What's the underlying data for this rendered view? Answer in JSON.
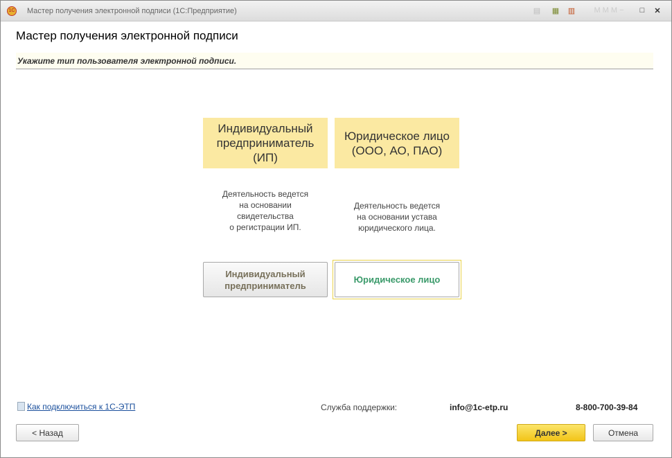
{
  "window": {
    "title": "Мастер получения электронной подписи  (1С:Предприятие)",
    "logo": "1С"
  },
  "header": {
    "title": "Мастер получения электронной подписи",
    "hint": "Укажите тип пользователя электронной подписи."
  },
  "options": [
    {
      "card": "Индивидуальный\nпредприниматель\n(ИП)",
      "description": "Деятельность ведется\nна основании\nсвидетельства\nо регистрации ИП.",
      "button": "Индивидуальный\nпредприниматель"
    },
    {
      "card": "Юридическое лицо\n(ООО, АО, ПАО)",
      "description": "Деятельность ведется\nна основании устава\nюридического лица.",
      "button": "Юридическое лицо"
    }
  ],
  "footer": {
    "help_link": "Как подключиться к 1С-ЭТП",
    "support_label": "Служба поддержки:",
    "email": "info@1c-etp.ru",
    "phone": "8-800-700-39-84"
  },
  "buttons": {
    "back": "< Назад",
    "next": "Далее >",
    "cancel": "Отмена"
  },
  "colors": {
    "card": "#fbe9a2",
    "accent": "#f2c418",
    "selected_text": "#3a9a6a"
  }
}
